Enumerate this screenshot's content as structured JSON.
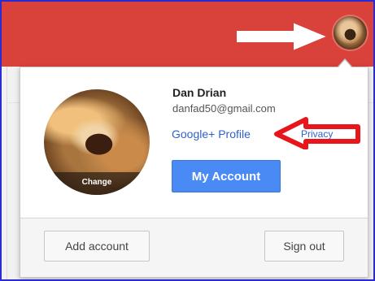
{
  "topbar": {
    "color": "#d9423a"
  },
  "account": {
    "name": "Dan Drian",
    "email": "danfad50@gmail.com",
    "change_label": "Change",
    "google_plus_link": "Google+ Profile",
    "privacy_link": "Privacy",
    "my_account_button": "My Account"
  },
  "footer": {
    "add_account_button": "Add account",
    "sign_out_button": "Sign out"
  },
  "annotations": {
    "white_arrow": "arrow-right-icon",
    "red_arrow": "arrow-left-icon",
    "red_arrow_color": "#e8151b"
  }
}
